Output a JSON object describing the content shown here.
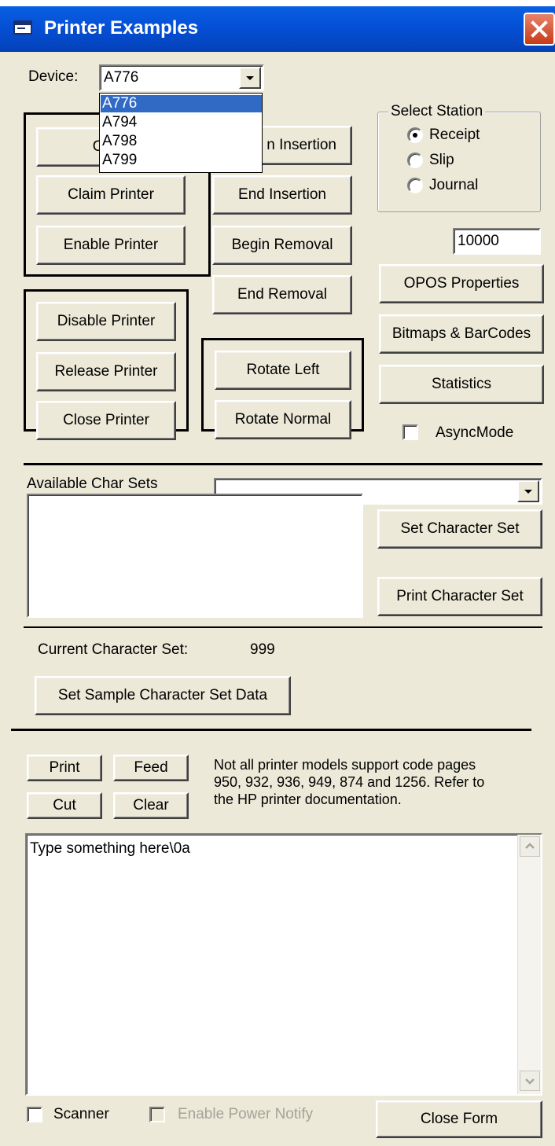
{
  "window": {
    "title": "Printer Examples",
    "close_icon": "close-icon",
    "title_icon": "window-icon"
  },
  "device": {
    "label": "Device:",
    "selected": "A776",
    "options": [
      "A776",
      "A794",
      "A798",
      "A799"
    ]
  },
  "buttons": {
    "open": "Open",
    "claim": "Claim Printer",
    "enable": "Enable Printer",
    "disable": "Disable Printer",
    "release": "Release Printer",
    "close": "Close Printer",
    "begin_insertion_visible": "n Insertion",
    "end_insertion": "End Insertion",
    "begin_removal": "Begin Removal",
    "end_removal": "End Removal",
    "rotate_left": "Rotate Left",
    "rotate_normal": "Rotate Normal",
    "opos_properties": "OPOS Properties",
    "bitmaps": "Bitmaps & BarCodes",
    "statistics": "Statistics",
    "set_char_set": "Set Character Set",
    "print_char_set": "Print Character Set",
    "set_sample": "Set Sample Character Set Data",
    "print": "Print",
    "feed": "Feed",
    "cut": "Cut",
    "clear": "Clear",
    "close_form": "Close Form"
  },
  "station": {
    "title": "Select Station",
    "options": [
      {
        "label": "Receipt",
        "selected": true
      },
      {
        "label": "Slip",
        "selected": false
      },
      {
        "label": "Journal",
        "selected": false
      }
    ]
  },
  "timeout_value": "10000",
  "async_mode": {
    "label": "AsyncMode",
    "checked": false
  },
  "charsets": {
    "label": "Available Char Sets",
    "selected": "",
    "current_label": "Current Character Set:",
    "current_value": "999"
  },
  "note": {
    "line1": "Not all printer models support code pages",
    "line2": "950, 932, 936, 949, 874 and 1256. Refer to",
    "line3": "the HP printer documentation."
  },
  "text_area": {
    "value": "Type something here\\0a"
  },
  "scanner": {
    "label": "Scanner",
    "checked": false
  },
  "power_notify": {
    "label": "Enable Power Notify",
    "checked": false,
    "enabled": false
  },
  "colors": {
    "titlebar": "#0551d8",
    "face": "#ece9d8",
    "selection": "#316ac5"
  }
}
